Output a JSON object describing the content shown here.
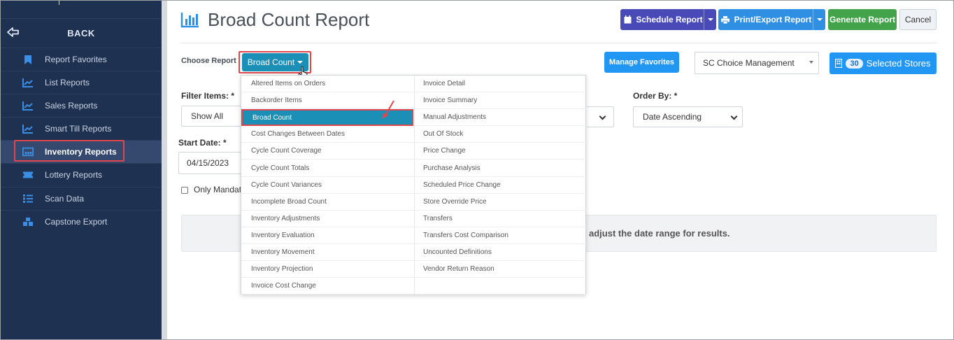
{
  "sidebar": {
    "back_label": "BACK",
    "items": [
      {
        "label": "Report Favorites",
        "icon": "bookmark-icon"
      },
      {
        "label": "List Reports",
        "icon": "line-chart-icon"
      },
      {
        "label": "Sales Reports",
        "icon": "line-chart-icon"
      },
      {
        "label": "Smart Till Reports",
        "icon": "line-chart-icon"
      },
      {
        "label": "Inventory Reports",
        "icon": "inventory-icon",
        "active": true
      },
      {
        "label": "Lottery Reports",
        "icon": "ticket-icon"
      },
      {
        "label": "Scan Data",
        "icon": "list-icon"
      },
      {
        "label": "Capstone Export",
        "icon": "boxes-icon"
      }
    ]
  },
  "header": {
    "title": "Broad Count Report",
    "schedule_label": "Schedule Report",
    "print_label": "Print/Export Report",
    "generate_label": "Generate Report",
    "cancel_label": "Cancel"
  },
  "choose": {
    "label": "Choose Report",
    "selected": "Broad Count",
    "manage_label": "Manage Favorites",
    "store_group": "SC Choice Management",
    "stores_count": "30",
    "stores_label": "Selected Stores"
  },
  "filters": {
    "filter_label": "Filter Items: *",
    "filter_value": "Show All",
    "orderby_label": "Order By: *",
    "orderby_value": "Date Ascending",
    "start_label": "Start Date: *",
    "start_value": "04/15/2023",
    "only_label": "Only Mandato"
  },
  "alert": {
    "text": "adjust the date range for results."
  },
  "menu": {
    "left": [
      "Altered Items on Orders",
      "Backorder Items",
      "Broad Count",
      "Cost Changes Between Dates",
      "Cycle Count Coverage",
      "Cycle Count Totals",
      "Cycle Count Variances",
      "Incomplete Broad Count",
      "Inventory Adjustments",
      "Inventory Evaluation",
      "Inventory Movement",
      "Inventory Projection",
      "Invoice Cost Change"
    ],
    "right": [
      "Invoice Detail",
      "Invoice Summary",
      "Manual Adjustments",
      "Out Of Stock",
      "Price Change",
      "Purchase Analysis",
      "Scheduled Price Change",
      "Store Override Price",
      "Transfers",
      "Transfers Cost Comparison",
      "Uncounted Definitions",
      "Vendor Return Reason",
      ""
    ],
    "selected_index": 2
  },
  "colors": {
    "sidebar_bg": "#1f3150",
    "accent_blue": "#2196f3",
    "teal": "#1b8fb5",
    "schedule": "#4a49b8",
    "generate": "#43a34a",
    "highlight_red": "#e0474c"
  }
}
